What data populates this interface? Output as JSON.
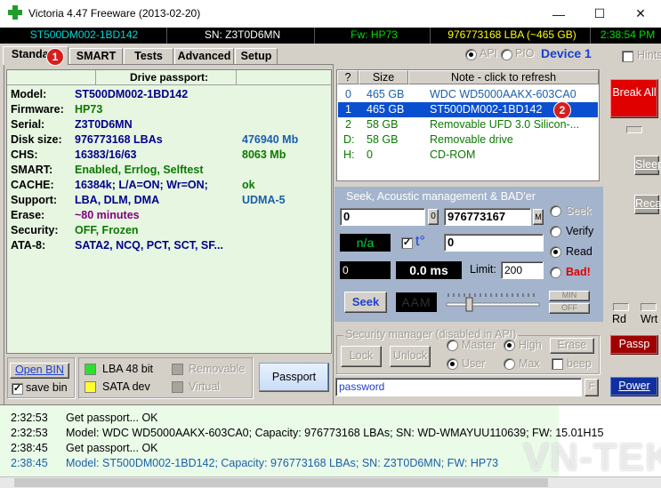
{
  "window": {
    "title": "Victoria 4.47  Freeware (2013-02-20)",
    "minimize_glyph": "—",
    "maximize_glyph": "☐",
    "close_glyph": "✕"
  },
  "status_bar": {
    "model": "ST500DM002-1BD142",
    "serial": "SN: Z3T0D6MN",
    "firmware": "Fw: HP73",
    "lba": "976773168 LBA (~465 GB)",
    "time": "2:38:54 PM",
    "colors": {
      "model": "#00d8d8",
      "serial": "#ffffff",
      "firmware": "#00e000",
      "lba": "#ffff00",
      "time": "#00e000"
    }
  },
  "tabs": [
    {
      "label": "Standard",
      "active": true
    },
    {
      "label": "SMART",
      "active": false
    },
    {
      "label": "Tests",
      "active": false
    },
    {
      "label": "Advanced",
      "active": false
    },
    {
      "label": "Setup",
      "active": false
    }
  ],
  "mode": {
    "api_label": "API",
    "pio_label": "PIO",
    "device_label": "Device 1",
    "hints_label": "Hints"
  },
  "passport": {
    "header": "Drive passport:",
    "rows": [
      {
        "label": "Model:",
        "value": "ST500DM002-1BD142",
        "value2": ""
      },
      {
        "label": "Firmware:",
        "value": "HP73",
        "value2": ""
      },
      {
        "label": "Serial:",
        "value": "Z3T0D6MN",
        "value2": ""
      },
      {
        "label": "Disk size:",
        "value": "976773168 LBAs",
        "value2": "476940 Mb"
      },
      {
        "label": "CHS:",
        "value": "16383/16/63",
        "value2": "8063 Mb"
      },
      {
        "label": "SMART:",
        "value": "Enabled, Errlog, Selftest",
        "value2": ""
      },
      {
        "label": "CACHE:",
        "value": "16384k; L/A=ON; Wr=ON;",
        "value2": "ok"
      },
      {
        "label": "Support:",
        "value": "LBA, DLM, DMA",
        "value2": "UDMA-5"
      },
      {
        "label": "Erase:",
        "value": "~80 minutes",
        "value2": ""
      },
      {
        "label": "Security:",
        "value": "OFF, Frozen",
        "value2": ""
      },
      {
        "label": "ATA-8:",
        "value": "SATA2, NCQ, PCT, SCT, SF...",
        "value2": ""
      }
    ]
  },
  "bottom_left": {
    "open_bin": "Open BIN",
    "save_bin": "save bin",
    "lba48": "LBA 48 bit",
    "sata_dev": "SATA dev",
    "removable": "Removable",
    "virtual": "Virtual",
    "passport_button": "Passport"
  },
  "drive_list": {
    "headers": [
      "?",
      "Size",
      "Note - click to refresh"
    ],
    "rows": [
      {
        "id": "0",
        "size": "465 GB",
        "note": "WDC WD5000AAKX-603CA0",
        "selected": false,
        "color": "#1a5faa"
      },
      {
        "id": "1",
        "size": "465 GB",
        "note": "ST500DM002-1BD142",
        "selected": true,
        "color": "#ffffff"
      },
      {
        "id": "2",
        "size": "58 GB",
        "note": "Removable UFD 3.0 Silicon-...",
        "selected": false,
        "color": "#0a7a00"
      },
      {
        "id": "D:",
        "size": "58 GB",
        "note": "Removable drive",
        "selected": false,
        "color": "#0a7a00"
      },
      {
        "id": "H:",
        "size": "0",
        "note": "CD-ROM",
        "selected": false,
        "color": "#0a7a00"
      }
    ]
  },
  "seek": {
    "title": "Seek, Acoustic management & BAD'er",
    "start_lba": "0",
    "start_unit": "0",
    "end_lba": "976773167",
    "end_unit": "M",
    "na_text": "n/a",
    "temp_label": "t°",
    "temp_value": "0",
    "count_value": "0",
    "ms_value": "0.0 ms",
    "limit_label": "Limit:",
    "limit_value": "200",
    "radio_seek": "Seek",
    "radio_verify": "Verify",
    "radio_read": "Read",
    "radio_bad": "Bad!",
    "seek_button": "Seek",
    "aam_text": "AAM",
    "min_label": "MIN",
    "off_label": "OFF"
  },
  "security": {
    "title": "Security manager (disabled in API)",
    "lock": "Lock",
    "unlock": "Unlock",
    "master": "Master",
    "high": "High",
    "erase": "Erase",
    "user": "User",
    "max": "Max",
    "beep": "beep",
    "password_value": "password",
    "f_label": "F"
  },
  "right_bar": {
    "break_all": "Break All",
    "sleep": "Sleep",
    "recall": "Recall",
    "rd": "Rd",
    "wrt": "Wrt",
    "passp": "Passp",
    "power": "Power"
  },
  "log": [
    {
      "time": "2:32:53",
      "message": "Get passport... OK",
      "color": "#000000"
    },
    {
      "time": "2:32:53",
      "message": "Model: WDC WD5000AAKX-603CA0; Capacity: 976773168 LBAs; SN: WD-WMAYUU110639; FW: 15.01H15",
      "color": "#000000"
    },
    {
      "time": "2:38:45",
      "message": "Get passport... OK",
      "color": "#000000"
    },
    {
      "time": "2:38:45",
      "message": "Model: ST500DM002-1BD142; Capacity: 976773168 LBAs; SN: Z3T0D6MN; FW: HP73",
      "color": "#1a5faa"
    }
  ],
  "annotations": {
    "badge1": "1",
    "badge2": "2",
    "watermark": "VN-TEK"
  }
}
